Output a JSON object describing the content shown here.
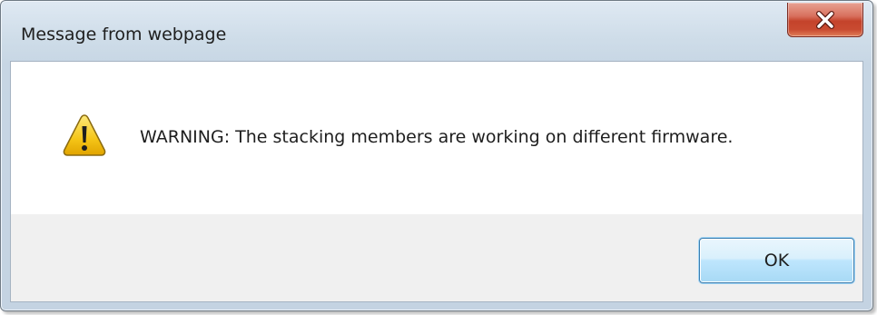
{
  "window": {
    "title": "Message from webpage",
    "close_icon": "close-x-icon"
  },
  "message": {
    "icon": "warning-triangle-icon",
    "text": "WARNING: The stacking members are working on different firmware."
  },
  "buttons": {
    "ok_label": "OK"
  },
  "colors": {
    "close_button_red": "#c4432b",
    "ok_button_border": "#3c7fb1",
    "warning_yellow": "#f5c517",
    "frame_blue": "#c7d6e4"
  }
}
